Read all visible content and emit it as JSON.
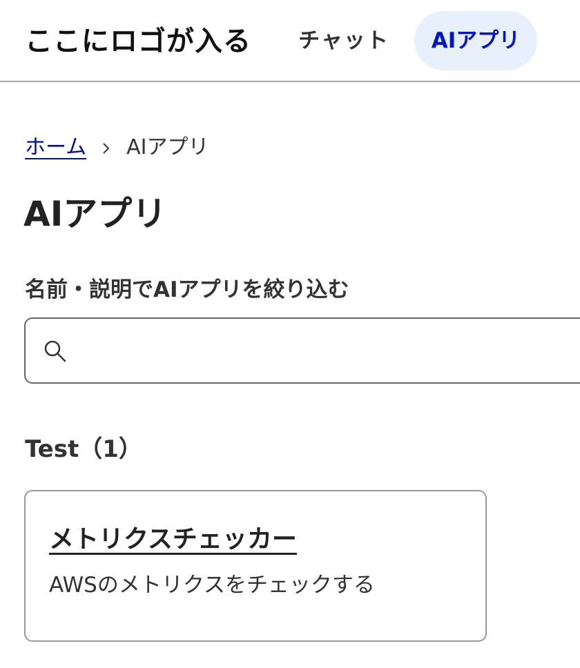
{
  "header": {
    "logo_text": "ここにロゴが入る",
    "nav": [
      {
        "label": "チャット",
        "active": false
      },
      {
        "label": "AIアプリ",
        "active": true
      }
    ]
  },
  "breadcrumb": {
    "home_label": "ホーム",
    "current_label": "AIアプリ",
    "separator_icon": "chevron-right-icon"
  },
  "page": {
    "title": "AIアプリ"
  },
  "filter": {
    "label": "名前・説明でAIアプリを絞り込む",
    "value": "",
    "placeholder": "",
    "icon": "search-icon"
  },
  "sections": [
    {
      "title": "Test（1）",
      "apps": [
        {
          "name": "メトリクスチェッカー",
          "description": "AWSのメトリクスをチェックする"
        }
      ]
    }
  ],
  "colors": {
    "accent": "#0017c1",
    "link": "#00118f",
    "active_nav_bg": "#e8f0fe",
    "border": "#666666"
  }
}
